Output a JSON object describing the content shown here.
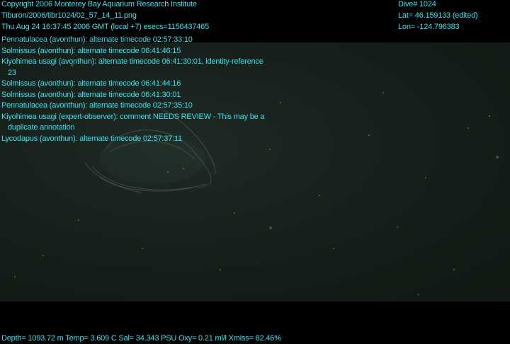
{
  "header": {
    "copyright": "Copyright 2006 Monterey Bay Aquarium Research Institute",
    "file_path": "Tiburon/2006/tibr1024/02_57_14_11.png",
    "datetime": "Thu Aug 24 16:37:45 2006 GMT (local +7)  esecs=1156437465",
    "dive": "Dive# 1024",
    "lat": "Lat= 46.159133 (edited)",
    "lon": "Lon= -124.796383"
  },
  "annotations": [
    {
      "text": "Pennatulacea (avonthun): alternate timecode 02:57:33:10"
    },
    {
      "text": "Solmissus (avonthun): alternate timecode 06:41:46:15"
    },
    {
      "text": "Kiyohimea usagi (avonthun): alternate timecode 06:41:30:01, identity-reference",
      "cont": "23"
    },
    {
      "text": "Solmissus (avonthun): alternate timecode 06:41:44:16"
    },
    {
      "text": "Solmissus (avonthun): alternate timecode 06:41:30:01"
    },
    {
      "text": "Pennatulacea (avonthun): alternate timecode 02:57:35:10"
    },
    {
      "text": "Kiyohimea usagi (expert-observer): comment NEEDS REVIEW - This may be a",
      "cont": "duplicate annotation"
    },
    {
      "text": "Lycodapus (avonthun): alternate timecode 02:57:37:11"
    }
  ],
  "footer": {
    "telemetry": "Depth= 1093.72 m  Temp= 3.609 C  Sal= 34.343 PSU  Oxy= 0.21 ml/l  Xmiss= 82.46%"
  },
  "colors": {
    "overlay_text": "#3fe0ef",
    "water": "#17201b",
    "letterbox": "#000000"
  }
}
